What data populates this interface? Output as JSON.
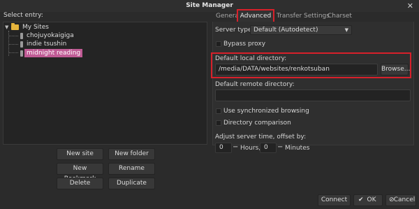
{
  "window": {
    "title": "Site Manager",
    "close_glyph": "✕"
  },
  "select_entry_label": "Select entry:",
  "tree": {
    "root": "My Sites",
    "items": [
      "chojuyokaigiga",
      "indie tsushin",
      "midnight reading"
    ]
  },
  "left_buttons": {
    "new_site": "New site",
    "new_folder": "New folder",
    "new_bookmark": "New Bookmark",
    "rename": "Rename",
    "delete": "Delete",
    "duplicate": "Duplicate"
  },
  "tabs": [
    "General",
    "Advanced",
    "Transfer Settings",
    "Charset"
  ],
  "advanced": {
    "server_type_label": "Server type:",
    "server_type_value": "Default (Autodetect)",
    "bypass_proxy": "Bypass proxy",
    "local_dir_label": "Default local directory:",
    "local_dir_value": "/media/DATA/websites/renkotsuban",
    "browse": "Browse...",
    "remote_dir_label": "Default remote directory:",
    "remote_dir_value": "",
    "sync_browsing": "Use synchronized browsing",
    "dir_comparison": "Directory comparison",
    "time_offset_label": "Adjust server time, offset by:",
    "hours_value": "0",
    "hours_label": "Hours,",
    "minutes_value": "0",
    "minutes_label": "Minutes"
  },
  "bottom_buttons": {
    "connect": "Connect",
    "ok": "OK",
    "cancel": "Cancel"
  },
  "colors": {
    "accent_highlight": "#d7202a",
    "selection": "#c05b95",
    "folder": "#e5b43c"
  }
}
